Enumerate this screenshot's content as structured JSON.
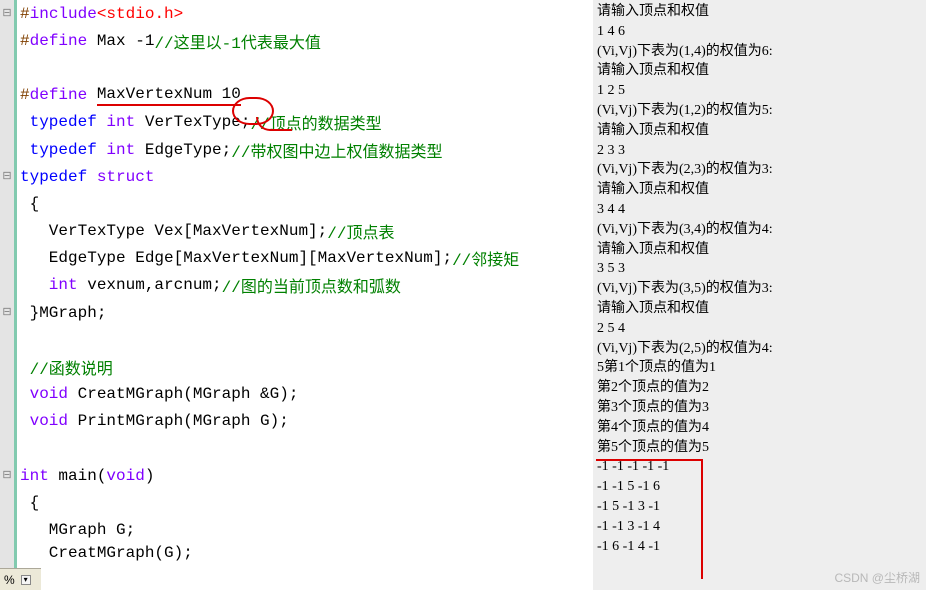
{
  "code": {
    "l1_pp": "#",
    "l1_inc": "include",
    "l1_hdr": "<stdio.h>",
    "l2_pp": "#",
    "l2_def": "define",
    "l2_body": " Max -1",
    "l2_com": "//这里以-1代表最大值",
    "l4_pp": "#",
    "l4_def": "define",
    "l4_body1": " ",
    "l4_body2": "MaxVertexNum 10",
    "l5_kw": " typedef ",
    "l5_typ": "int",
    "l5_body": " VerTexType;",
    "l5_com": "//顶点的数据类型",
    "l6_kw": " typedef ",
    "l6_typ": "int",
    "l6_body": " EdgeType;",
    "l6_com": "//带权图中边上权值数据类型",
    "l7_kw": "typedef ",
    "l7_typ": "struct",
    "l8": " {",
    "l9_body": "   VerTexType Vex[MaxVertexNum];",
    "l9_com": "//顶点表",
    "l10_body": "   EdgeType Edge[MaxVertexNum][MaxVertexNum];",
    "l10_com": "//邻接矩",
    "l11_typ": "   int",
    "l11_body": " vexnum,arcnum;",
    "l11_com": "//图的当前顶点数和弧数",
    "l12": " }MGraph;",
    "l14_com": " //函数说明",
    "l15_typ": " void",
    "l15_body": " CreatMGraph(MGraph &G);",
    "l16_typ": " void",
    "l16_body": " PrintMGraph(MGraph G);",
    "l18_typ": "int",
    "l18_body": " main(",
    "l18_void": "void",
    "l18_body2": ")",
    "l19": " {",
    "l20": "   MGraph G;",
    "l21": "   CreatMGraph(G);"
  },
  "gutter": {
    "g1": "⊟",
    "g7": "⊟",
    "g12": "⊟",
    "g18": "⊟"
  },
  "status": {
    "pct": "%",
    "arrow": "▾"
  },
  "output": {
    "o1": "请输入顶点和权值",
    "o2": "1 4 6",
    "o3": "(Vi,Vj)下表为(1,4)的权值为6:",
    "o4": "请输入顶点和权值",
    "o5": "1 2 5",
    "o6": "(Vi,Vj)下表为(1,2)的权值为5:",
    "o7": "请输入顶点和权值",
    "o8": "2 3 3",
    "o9": "(Vi,Vj)下表为(2,3)的权值为3:",
    "o10": "请输入顶点和权值",
    "o11": "3 4 4",
    "o12": "(Vi,Vj)下表为(3,4)的权值为4:",
    "o13": "请输入顶点和权值",
    "o14": "3 5 3",
    "o15": "(Vi,Vj)下表为(3,5)的权值为3:",
    "o16": "请输入顶点和权值",
    "o17": "2 5 4",
    "o18": "(Vi,Vj)下表为(2,5)的权值为4:",
    "o19": "5第1个顶点的值为1",
    "o20": "第2个顶点的值为2",
    "o21": "第3个顶点的值为3",
    "o22": "第4个顶点的值为4",
    "o23": "第5个顶点的值为5",
    "o24": "-1 -1 -1 -1 -1",
    "o25": "-1 -1 5 -1 6",
    "o26": "-1 5 -1 3 -1",
    "o27": "-1 -1 3 -1 4",
    "o28": "-1 6 -1 4 -1"
  },
  "watermark": "CSDN @尘桥湖"
}
